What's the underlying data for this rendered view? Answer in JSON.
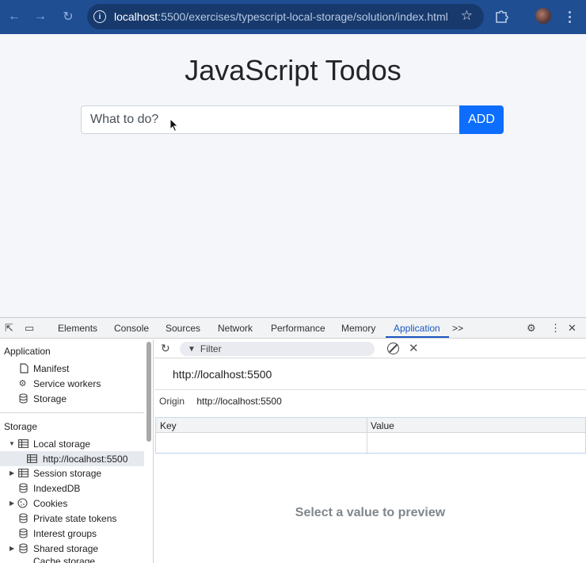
{
  "browser": {
    "url_host": "localhost",
    "url_path": ":5500/exercises/typescript-local-storage/solution/index.html"
  },
  "page": {
    "title": "JavaScript Todos",
    "input_placeholder": "What to do?",
    "add_label": "ADD"
  },
  "devtools": {
    "tabs": [
      {
        "label": "Elements"
      },
      {
        "label": "Console"
      },
      {
        "label": "Sources"
      },
      {
        "label": "Network"
      },
      {
        "label": "Performance"
      },
      {
        "label": "Memory"
      },
      {
        "label": "Application",
        "active": true
      }
    ],
    "more_tabs": ">>",
    "sidebar": {
      "application_header": "Application",
      "application_items": [
        "Manifest",
        "Service workers",
        "Storage"
      ],
      "storage_header": "Storage",
      "storage_items": [
        "Local storage",
        "http://localhost:5500",
        "Session storage",
        "IndexedDB",
        "Cookies",
        "Private state tokens",
        "Interest groups",
        "Shared storage",
        "Cache storage"
      ]
    },
    "toolbar": {
      "filter_placeholder": "Filter"
    },
    "main": {
      "origin_title": "http://localhost:5500",
      "origin_key": "Origin",
      "origin_value": "http://localhost:5500",
      "table_headers": [
        "Key",
        "Value"
      ],
      "preview_text": "Select a value to preview"
    }
  },
  "colors": {
    "chrome_bg": "#1f4e93",
    "accent": "#0d6efd",
    "devtools_active": "#1a57c4"
  }
}
